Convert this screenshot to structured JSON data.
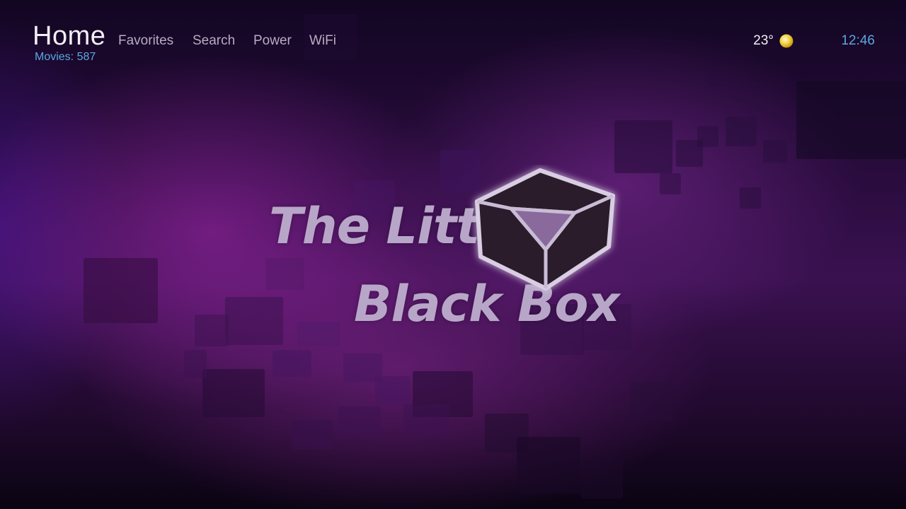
{
  "header": {
    "title": "Home",
    "subtitle": "Movies: 587"
  },
  "nav": {
    "items": [
      {
        "label": "Favorites",
        "name": "nav-favorites"
      },
      {
        "label": "Search",
        "name": "nav-search"
      },
      {
        "label": "Power",
        "name": "nav-power"
      },
      {
        "label": "WiFi",
        "name": "nav-wifi"
      }
    ]
  },
  "status": {
    "temperature": "23°",
    "weather_icon": "sun-icon",
    "time": "12:46"
  },
  "logo": {
    "line1": "The Little",
    "line2": "Black Box",
    "icon": "box-icon"
  },
  "colors": {
    "accent": "#5aa8e0",
    "background": "#3a1150",
    "logo_text": "#b8a6c8"
  }
}
